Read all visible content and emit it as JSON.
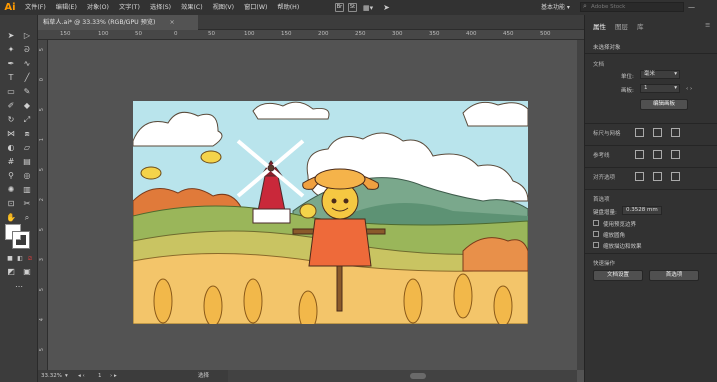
{
  "app": {
    "logo": "Ai"
  },
  "menu": [
    "文件(F)",
    "编辑(E)",
    "对象(O)",
    "文字(T)",
    "选择(S)",
    "效果(C)",
    "视图(V)",
    "窗口(W)",
    "帮助(H)"
  ],
  "menu_icons": [
    "Br",
    "St"
  ],
  "workspace": "基本功能",
  "search": {
    "placeholder": "Adobe Stock"
  },
  "tab": {
    "title": "稻草人.ai* @ 33.33% (RGB/GPU 预览)",
    "close": "×"
  },
  "ruler": {
    "h": [
      "150",
      "100",
      "50",
      "0",
      "50",
      "100",
      "150",
      "200",
      "250",
      "300",
      "350",
      "400",
      "450",
      "500"
    ],
    "v": [
      "5",
      "0",
      "5",
      "1",
      "5",
      "2",
      "5",
      "3",
      "5",
      "4",
      "5"
    ]
  },
  "status": {
    "zoom": "33.32%",
    "page": "1",
    "tool": "选择"
  },
  "panel": {
    "tabs": [
      "属性",
      "图层",
      "库"
    ],
    "no_selection": "未选择对象",
    "document": {
      "title": "文档",
      "units_label": "单位:",
      "units_value": "毫米",
      "artboard_label": "画板:",
      "artboard_value": "1",
      "edit_button": "编辑画板"
    },
    "ruler_grid": "标尺与网格",
    "guides": "参考线",
    "align": "对齐选项",
    "preferences": {
      "title": "首选项",
      "nudge_label": "键盘增量:",
      "nudge_value": "0.3528 mm",
      "options": [
        "使用预览边界",
        "缩放圆角",
        "缩放描边和效果"
      ]
    },
    "quick": {
      "title": "快速操作",
      "doc_setup": "文档设置",
      "prefs": "首选项"
    }
  },
  "colors": {
    "accent": "#ff9a00",
    "sky": "#b9e4ec",
    "field": "#f3c56a"
  }
}
